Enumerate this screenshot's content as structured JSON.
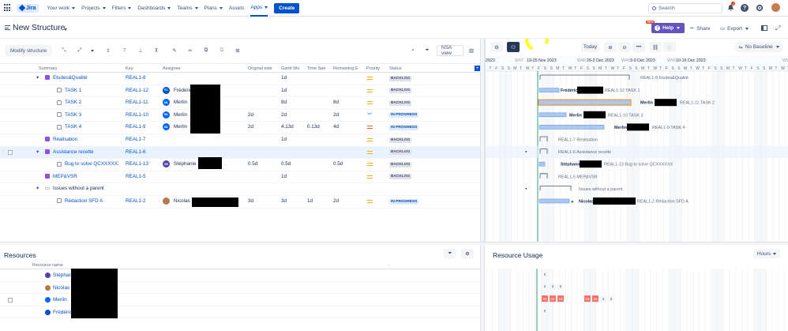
{
  "nav": {
    "logo_text": "Jira",
    "items": [
      "Your work",
      "Projects",
      "Filters",
      "Dashboards",
      "Teams",
      "Plans",
      "Assets",
      "Apps"
    ],
    "create_label": "Create",
    "search_placeholder": "Search",
    "notification_count": "4"
  },
  "header": {
    "title": "New Structure",
    "new_badge": "NEW",
    "help_label": "Help",
    "share_label": "Share",
    "export_label": "Export"
  },
  "toolbar": {
    "modify_label": "Modify structure",
    "view_label": "NSA view"
  },
  "columns": [
    "Summary",
    "Key",
    "Assignee",
    "Original estir",
    "Gantt Wo",
    "Time Spe",
    "Remaining E",
    "Priority",
    "Status"
  ],
  "rows": [
    {
      "summary": "Etudes&Qualité",
      "key": "REAL1-8",
      "assignee": "",
      "orig": "",
      "gantt": "1d",
      "spent": "",
      "remaining": "",
      "status": "BACKLOG"
    },
    {
      "summary": "TASK 1",
      "key": "REAL1-12",
      "assignee": "Frédéric",
      "orig": "",
      "gantt": "1d",
      "spent": "",
      "remaining": "",
      "status": "BACKLOG"
    },
    {
      "summary": "TASK 2",
      "key": "REAL1-11",
      "assignee": "Merlin",
      "orig": "",
      "gantt": "8d",
      "spent": "",
      "remaining": "8d",
      "status": "BACKLOG"
    },
    {
      "summary": "TASK 3",
      "key": "REAL1-10",
      "assignee": "Merlin",
      "orig": "2d",
      "gantt": "2d",
      "spent": "",
      "remaining": "2d",
      "status": "IN PROGRESS"
    },
    {
      "summary": "TASK 4",
      "key": "REAL1-9",
      "assignee": "Merlin",
      "orig": "2d",
      "gantt": "4.13d",
      "spent": "0.13d",
      "remaining": "4d",
      "status": "IN PROGRESS"
    },
    {
      "summary": "Réalisation",
      "key": "REAL1-7",
      "assignee": "",
      "orig": "",
      "gantt": "1d",
      "spent": "",
      "remaining": "",
      "status": "BACKLOG"
    },
    {
      "summary": "Assistance recette",
      "key": "REAL1-6",
      "assignee": "",
      "orig": "",
      "gantt": "",
      "spent": "",
      "remaining": "",
      "status": "BACKLOG"
    },
    {
      "summary": "Bug to solve QCXXXXXX",
      "key": "REAL1-13",
      "assignee": "Stéphanie",
      "orig": "0.5d",
      "gantt": "0.5d",
      "spent": "",
      "remaining": "0.5d",
      "status": "BACKLOG"
    },
    {
      "summary": "MEP&VSR",
      "key": "REAL1-5",
      "assignee": "",
      "orig": "",
      "gantt": "1d",
      "spent": "",
      "remaining": "",
      "status": "BACKLOG"
    },
    {
      "summary": "Issues without a parent",
      "key": "",
      "assignee": "",
      "orig": "",
      "gantt": "",
      "spent": "",
      "remaining": "",
      "status": ""
    },
    {
      "summary": "Rédaction SFD A",
      "key": "REAL1-2",
      "assignee": "Nicolas",
      "orig": "3d",
      "gantt": "3d",
      "spent": "1d",
      "remaining": "2d",
      "status": "IN PROGRESS"
    }
  ],
  "gantt": {
    "today_label": "Today",
    "baseline_label": "No Baseline",
    "weeks": [
      "2023",
      "W47",
      "19-25 Nov 2023",
      "W48",
      "26-2 Dec 2023",
      "W49",
      "3-9 Dec 2023",
      "W50",
      "10-16 Dec 2023",
      "W5"
    ],
    "days": [
      "T",
      "F",
      "S",
      "S",
      "M",
      "T",
      "W",
      "T",
      "F",
      "S",
      "S",
      "M",
      "T",
      "W",
      "T",
      "F",
      "S",
      "S",
      "M",
      "T",
      "W",
      "T",
      "F",
      "S",
      "S",
      "M",
      "T",
      "W",
      "T",
      "F",
      "S",
      "S",
      "M",
      "T",
      "W",
      "T",
      "F",
      "S",
      "S",
      "M",
      "T",
      "W",
      "T",
      "F",
      "S",
      "S",
      "M",
      "T",
      "W",
      "T"
    ],
    "labels": [
      "REAL1-8 Etudes&Qualité",
      "Frédéric",
      "REAL1-12 TASK 1",
      "Merlin",
      "REAL1-11 TASK 2",
      "Merlin",
      "REAL1-10 TASK 3",
      "Merlin",
      "REAL1-9 TASK 4",
      "REAL1-7 Réalisation",
      "REAL1-6 Assistance recette",
      "Stéphanie",
      "REAL1-13 Bug to solve QCXXXXXX",
      "REAL1-5 MEP&VSR",
      "Issues without a parent",
      "Nicolas",
      "REAL1-2 Rédaction SFD A"
    ]
  },
  "resources": {
    "title": "Resources",
    "column": "Resource name",
    "items": [
      "Stéphanie",
      "Nicolas S",
      "Merlin",
      "Frédéric"
    ]
  },
  "usage": {
    "title": "Resource Usage",
    "hours_label": "Hours",
    "rows": [
      [
        "8"
      ],
      [
        "8",
        "8",
        "8"
      ],
      [
        "24",
        "24",
        "16",
        "16",
        "16",
        "8",
        "8"
      ],
      [
        "8"
      ]
    ]
  }
}
